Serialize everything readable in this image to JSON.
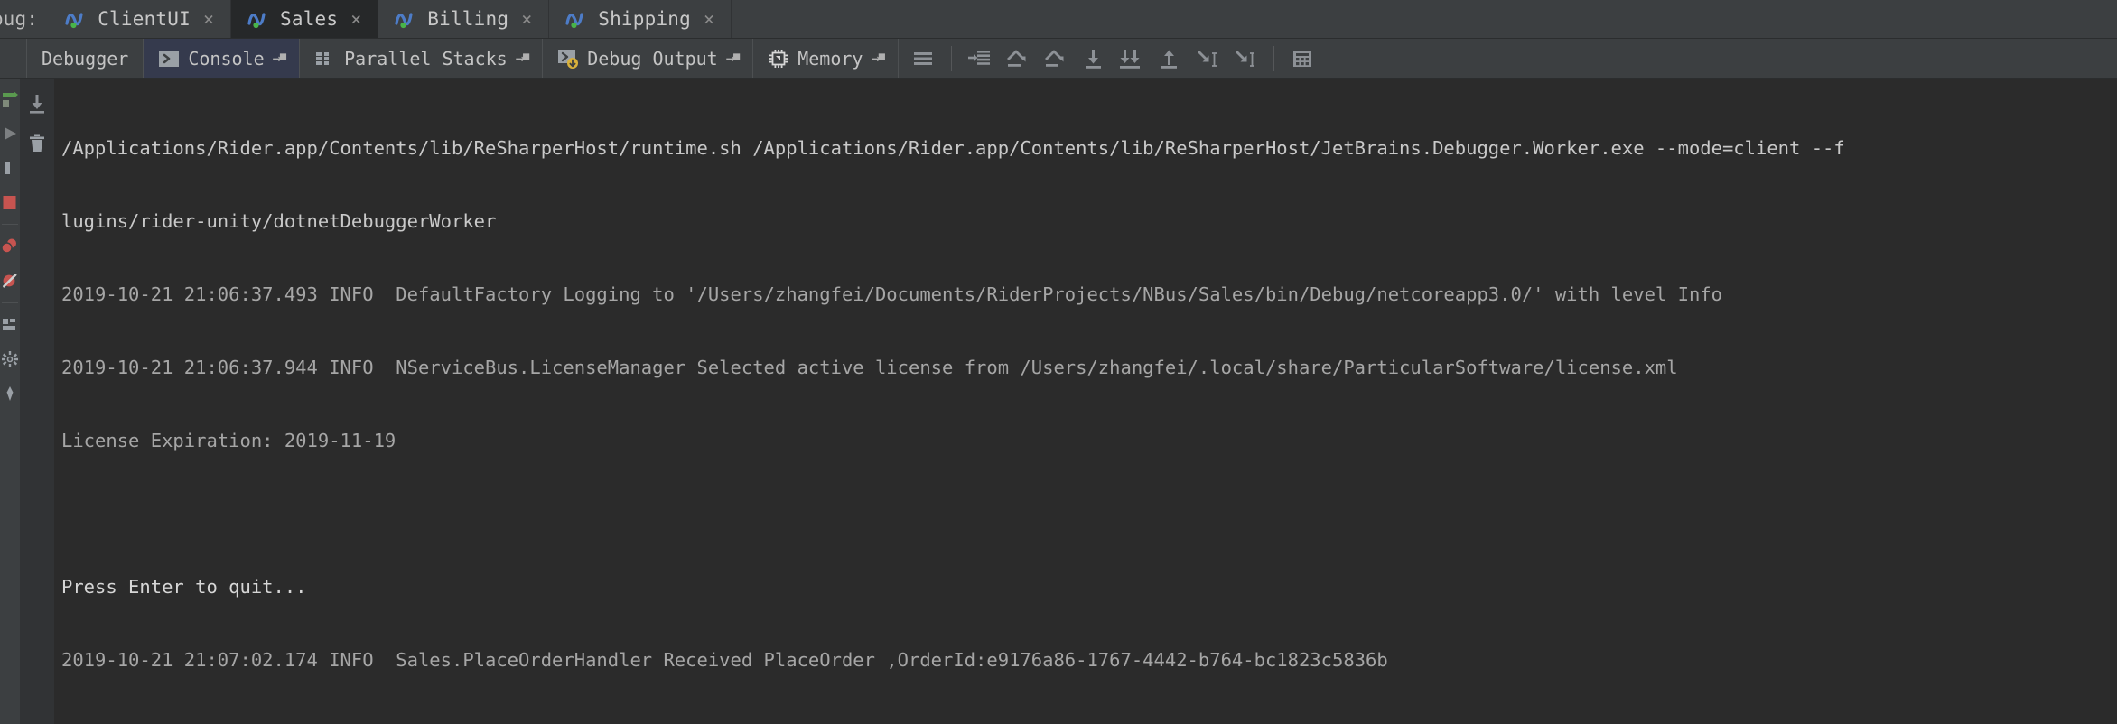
{
  "window": {
    "debug_label": "ebug:",
    "tabs": [
      {
        "label": "ClientUI",
        "icon": "nservicebus-icon",
        "close": "×",
        "active": false
      },
      {
        "label": "Sales",
        "icon": "nservicebus-icon",
        "close": "×",
        "active": true
      },
      {
        "label": "Billing",
        "icon": "nservicebus-icon",
        "close": "×",
        "active": false
      },
      {
        "label": "Shipping",
        "icon": "nservicebus-icon",
        "close": "×",
        "active": false
      }
    ]
  },
  "toolbar": {
    "tabs": [
      {
        "label": "Debugger",
        "icon": "none",
        "pinned": false,
        "selected": false
      },
      {
        "label": "Console",
        "icon": "console-icon",
        "pinned": true,
        "selected": true
      },
      {
        "label": "Parallel Stacks",
        "icon": "grid-stack-icon",
        "pinned": true,
        "selected": false
      },
      {
        "label": "Debug Output",
        "icon": "console-down-icon",
        "pinned": true,
        "selected": false
      },
      {
        "label": "Memory",
        "icon": "chip-icon",
        "pinned": true,
        "selected": false
      }
    ],
    "pin_glyph": "→",
    "actions": [
      {
        "name": "show-all-frames-icon",
        "title": "Show All Frames"
      },
      {
        "name": "step-over-icon",
        "title": "Step Over"
      },
      {
        "name": "force-step-over-icon",
        "title": "Force Step Over"
      },
      {
        "name": "step-into-icon",
        "title": "Step Into"
      },
      {
        "name": "force-step-into-icon",
        "title": "Force Step Into"
      },
      {
        "name": "step-out-icon",
        "title": "Step Out"
      },
      {
        "name": "run-to-cursor-icon",
        "title": "Run to Cursor"
      },
      {
        "name": "force-run-to-cursor-icon",
        "title": "Force Run to Cursor"
      },
      {
        "name": "evaluate-expression-icon",
        "title": "Evaluate Expression"
      }
    ]
  },
  "left_actions": [
    {
      "name": "rerun-icon",
      "title": "Rerun"
    },
    {
      "name": "resume-program-icon",
      "title": "Resume Program"
    },
    {
      "name": "pause-program-icon",
      "title": "Pause Program"
    },
    {
      "name": "stop-icon",
      "title": "Stop"
    },
    {
      "name": "view-breakpoints-icon",
      "title": "View Breakpoints"
    },
    {
      "name": "mute-breakpoints-icon",
      "title": "Mute Breakpoints"
    },
    {
      "name": "layout-settings-icon",
      "title": "Layout Settings"
    },
    {
      "name": "settings-gear-icon",
      "title": "Settings"
    },
    {
      "name": "pin-tab-icon",
      "title": "Pin Tab"
    }
  ],
  "console_gutter": [
    {
      "name": "scroll-to-end-icon",
      "title": "Scroll to the end"
    },
    {
      "name": "trash-icon",
      "title": "Clear All"
    }
  ],
  "console": {
    "lines": [
      {
        "kind": "cmd",
        "text": "/Applications/Rider.app/Contents/lib/ReSharperHost/runtime.sh /Applications/Rider.app/Contents/lib/ReSharperHost/JetBrains.Debugger.Worker.exe --mode=client --f"
      },
      {
        "kind": "cmd",
        "text": "lugins/rider-unity/dotnetDebuggerWorker"
      },
      {
        "kind": "log",
        "text": "2019-10-21 21:06:37.493 INFO  DefaultFactory Logging to '/Users/zhangfei/Documents/RiderProjects/NBus/Sales/bin/Debug/netcoreapp3.0/' with level Info"
      },
      {
        "kind": "log",
        "text": "2019-10-21 21:06:37.944 INFO  NServiceBus.LicenseManager Selected active license from /Users/zhangfei/.local/share/ParticularSoftware/license.xml"
      },
      {
        "kind": "log",
        "text": "License Expiration: 2019-11-19"
      },
      {
        "kind": "blank",
        "text": " "
      },
      {
        "kind": "plain",
        "text": "Press Enter to quit..."
      },
      {
        "kind": "log",
        "text": "2019-10-21 21:07:02.174 INFO  Sales.PlaceOrderHandler Received PlaceOrder ,OrderId:e9176a86-1767-4442-b764-bc1823c5836b"
      }
    ]
  },
  "colors": {
    "toolbar_bg": "#3c3f41",
    "console_bg": "#2b2b2b",
    "active_tab_bg": "#262829",
    "selected_tool_bg": "#353a4d",
    "icon_grey": "#9aa0a6",
    "breakpoint_red": "#c75450",
    "run_green": "#5a9a4f",
    "badge_yellow": "#d9b13b"
  }
}
